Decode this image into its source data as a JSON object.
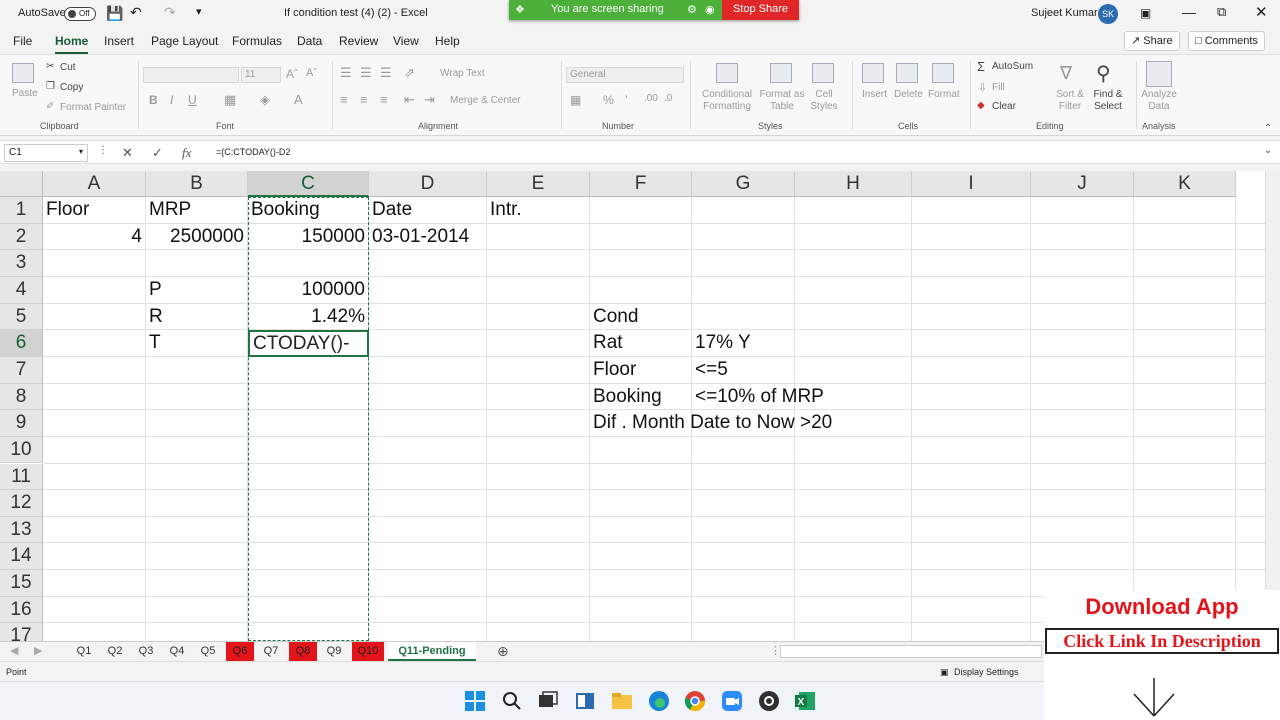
{
  "titlebar": {
    "autosave_label": "AutoSave",
    "autosave_state": "Off",
    "doc_title": "If condition test (4) (2)  -  Excel",
    "user_name": "Sujeet Kumar",
    "user_initials": "SK"
  },
  "share_banner": {
    "text": "You are screen sharing",
    "stop_label": "Stop Share"
  },
  "menu": {
    "tabs": [
      "File",
      "Home",
      "Insert",
      "Page Layout",
      "Formulas",
      "Data",
      "Review",
      "View",
      "Help"
    ],
    "active": "Home",
    "share_label": "Share",
    "comments_label": "Comments"
  },
  "ribbon": {
    "clipboard": {
      "paste": "Paste",
      "cut": "Cut",
      "copy": "Copy",
      "format_painter": "Format Painter",
      "group": "Clipboard"
    },
    "font": {
      "group": "Font",
      "size": "11"
    },
    "alignment": {
      "wrap": "Wrap Text",
      "merge": "Merge & Center",
      "group": "Alignment"
    },
    "number": {
      "format": "General",
      "group": "Number"
    },
    "styles": {
      "conditional": "Conditional Formatting",
      "format_table": "Format as Table",
      "cell_styles": "Cell Styles",
      "group": "Styles"
    },
    "cells": {
      "insert": "Insert",
      "delete": "Delete",
      "format": "Format",
      "group": "Cells"
    },
    "editing": {
      "autosum": "AutoSum",
      "fill": "Fill",
      "clear": "Clear",
      "sort": "Sort & Filter",
      "find": "Find & Select",
      "group": "Editing"
    },
    "analysis": {
      "analyze": "Analyze Data",
      "group": "Analysis"
    }
  },
  "formula_bar": {
    "name_box": "C1",
    "formula": "=(C:CTODAY()-D2"
  },
  "columns": [
    "A",
    "B",
    "C",
    "D",
    "E",
    "F",
    "G",
    "H",
    "I",
    "J",
    "K"
  ],
  "rows": [
    "1",
    "2",
    "3",
    "4",
    "5",
    "6",
    "7",
    "8",
    "9",
    "10",
    "11",
    "12",
    "13",
    "14",
    "15",
    "16",
    "17"
  ],
  "cells": {
    "A1": "Floor",
    "B1": "MRP",
    "C1": "Booking",
    "D1": "Date",
    "E1": "Intr.",
    "A2": "4",
    "B2": "2500000",
    "C2": "150000",
    "D2": "03-01-2014",
    "B4": "P",
    "C4": "100000",
    "B5": "R",
    "C5": "1.42%",
    "B6": "T",
    "C6": "CTODAY()-",
    "F5": "Cond",
    "F6": "Rat",
    "G6": "17% Y",
    "F7": "Floor",
    "G7": "<=5",
    "F8": "Booking",
    "G8": "<=10% of MRP",
    "F9": "Dif . Month Date to Now >20"
  },
  "sheet_tabs": [
    "Q1",
    "Q2",
    "Q3",
    "Q4",
    "Q5",
    "Q6",
    "Q7",
    "Q8",
    "Q9",
    "Q10",
    "Q11-Pending"
  ],
  "red_tabs": [
    "Q6",
    "Q8",
    "Q10"
  ],
  "active_tab": "Q11-Pending",
  "status": {
    "mode": "Point",
    "display_settings": "Display Settings"
  },
  "promo": {
    "title": "Download App",
    "link": "Click Link In Description"
  },
  "colors": {
    "excel_green": "#217346",
    "promo_red": "#e3151a",
    "share_green": "#4caf3a"
  }
}
